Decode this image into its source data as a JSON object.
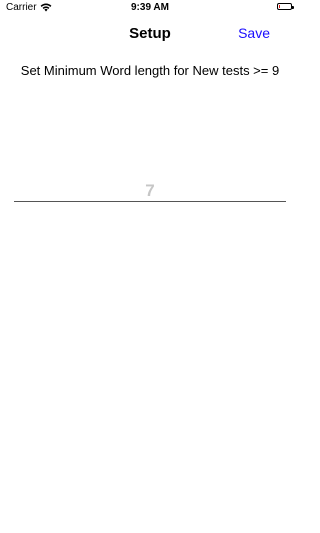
{
  "status_bar": {
    "carrier": "Carrier",
    "time": "9:39 AM"
  },
  "nav": {
    "title": "Setup",
    "save_label": "Save"
  },
  "setup": {
    "instruction": "Set Minimum Word length for New tests >= 9",
    "length_placeholder": "7"
  },
  "colors": {
    "accent": "#1a0dff",
    "battery_low": "#e0201b",
    "placeholder": "#c6c6c6"
  }
}
